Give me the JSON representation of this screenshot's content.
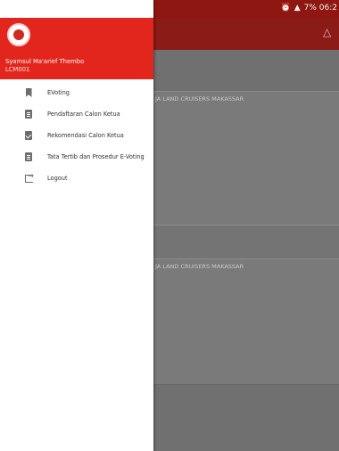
{
  "status_bar": {
    "right_text": "7% 06:2"
  },
  "drawer": {
    "user_name": "Syamsul Ma'arief Thembo",
    "user_id": "LCM001",
    "menu": [
      {
        "label": "EVoting",
        "icon": "bookmark-icon"
      },
      {
        "label": "Pendaftaran Calon Ketua",
        "icon": "clipboard-icon"
      },
      {
        "label": "Rekomendasi Calon Ketua",
        "icon": "check-clipboard-icon"
      },
      {
        "label": "Tata Tertib dan Prosedur E-Voting",
        "icon": "clipboard-icon"
      },
      {
        "label": "Logout",
        "icon": "logout-icon"
      }
    ]
  },
  "background": {
    "cards": [
      {
        "desc": "JA LAND CRUISERS MAKASSAR"
      },
      {
        "desc": "JA LAND CRUISERS MAKASSAR"
      }
    ]
  },
  "colors": {
    "header_red": "#e3261d",
    "status_bar": "#8e1712"
  }
}
